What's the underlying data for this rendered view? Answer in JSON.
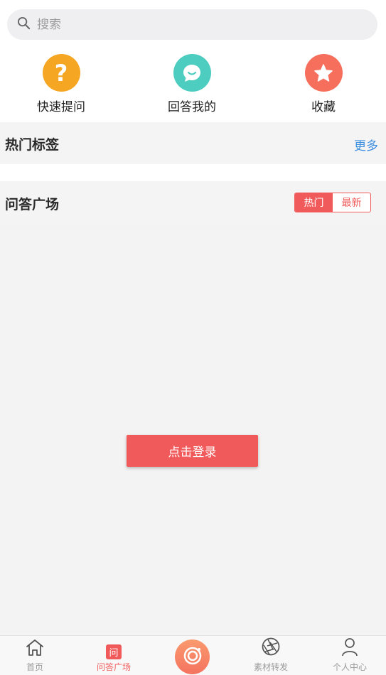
{
  "search": {
    "placeholder": "搜索",
    "icon": "search-icon"
  },
  "actions": [
    {
      "label": "快速提问",
      "icon": "question-icon",
      "color": "#f5a623"
    },
    {
      "label": "回答我的",
      "icon": "chat-bubble-icon",
      "color": "#4ccdc0"
    },
    {
      "label": "收藏",
      "icon": "star-icon",
      "color": "#f66f5d"
    }
  ],
  "hot_tags": {
    "title": "热门标签",
    "more": "更多"
  },
  "qa_square": {
    "title": "问答广场",
    "toggle": {
      "active": "热门",
      "inactive": "最新"
    }
  },
  "login_button": "点击登录",
  "tabbar": {
    "items": [
      {
        "label": "首页",
        "icon": "home-icon",
        "active": false
      },
      {
        "label": "问答广场",
        "icon": "wen-badge-icon",
        "badge": "问",
        "active": true
      },
      {
        "label": "",
        "icon": "camera-icon",
        "center": true
      },
      {
        "label": "素材转发",
        "icon": "aperture-icon",
        "active": false
      },
      {
        "label": "个人中心",
        "icon": "user-icon",
        "active": false
      }
    ]
  },
  "colors": {
    "accent": "#f15a5a",
    "link": "#3d8fe0",
    "background": "#f3f3f3"
  }
}
